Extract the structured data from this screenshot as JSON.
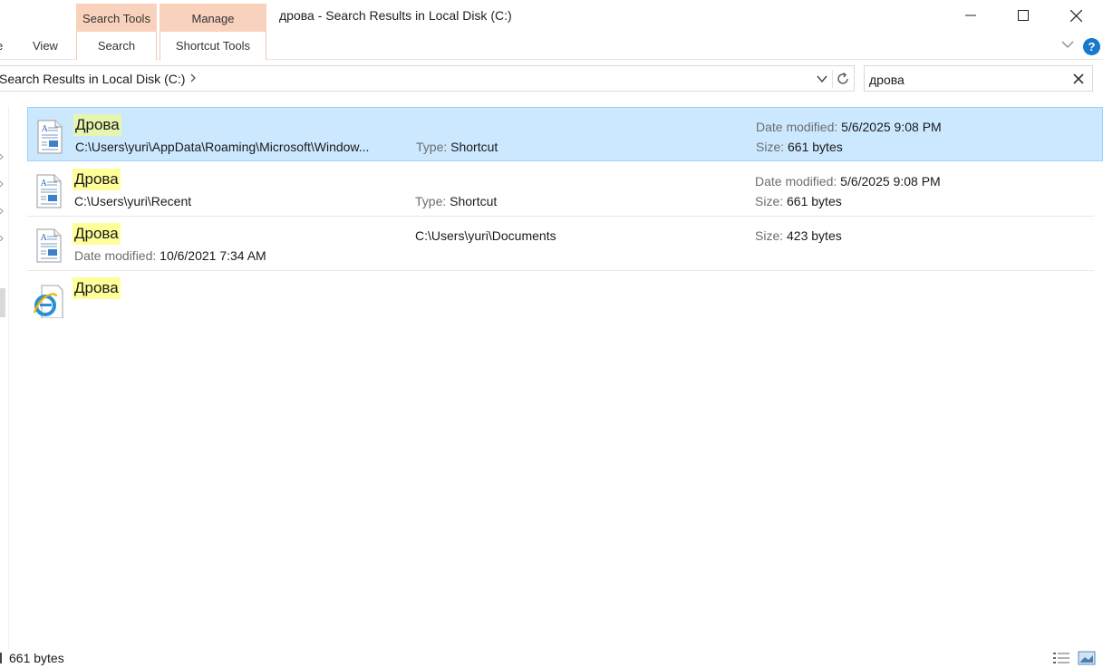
{
  "window": {
    "title": "дрова - Search Results in Local Disk (C:)"
  },
  "ribbon": {
    "cut_tab": "e",
    "view_tab": "View",
    "search_tools_header": "Search Tools",
    "search_tab": "Search",
    "manage_header": "Manage",
    "shortcut_tools_tab": "Shortcut Tools"
  },
  "address": {
    "crumb": "Search Results in Local Disk (C:)"
  },
  "search": {
    "query": "дрова"
  },
  "results": [
    {
      "name": "Дрова",
      "path": "C:\\Users\\yuri\\AppData\\Roaming\\Microsoft\\Window...",
      "type_label": "Type:",
      "type_value": "Shortcut",
      "date_label": "Date modified:",
      "date_value": "5/6/2025 9:08 PM",
      "size_label": "Size:",
      "size_value": "661 bytes"
    },
    {
      "name": "Дрова",
      "path": "C:\\Users\\yuri\\Recent",
      "type_label": "Type:",
      "type_value": "Shortcut",
      "date_label": "Date modified:",
      "date_value": "5/6/2025 9:08 PM",
      "size_label": "Size:",
      "size_value": "661 bytes"
    },
    {
      "name": "Дрова",
      "date_label": "Date modified:",
      "date_value": "10/6/2021 7:34 AM",
      "location": "C:\\Users\\yuri\\Documents",
      "size_label": "Size:",
      "size_value": "423 bytes"
    },
    {
      "name": "Дрова"
    }
  ],
  "status": {
    "text": "661 bytes"
  },
  "icons": {
    "row1": "shortcut-document-icon",
    "row2": "shortcut-document-icon",
    "row3": "text-document-icon",
    "row4": "internet-explorer-shortcut-icon"
  },
  "colors": {
    "selection_bg": "#cce8ff",
    "selection_border": "#99d1ff",
    "highlight": "#ffff99",
    "context_tab": "#f9d2bd",
    "help_blue": "#1979ca"
  }
}
